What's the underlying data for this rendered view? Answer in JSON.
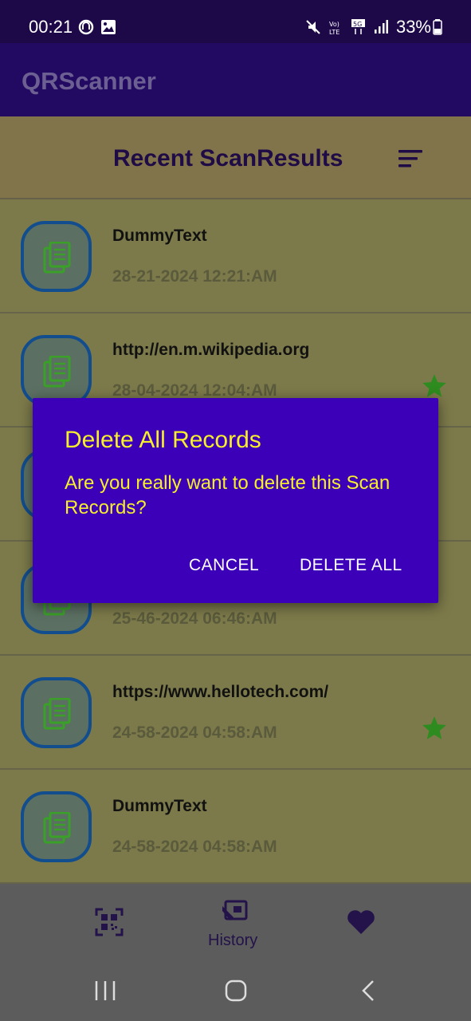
{
  "status_bar": {
    "time": "00:21",
    "battery": "33%"
  },
  "app_bar": {
    "title": "QRScanner"
  },
  "list_header": {
    "title": "Recent ScanResults"
  },
  "records": [
    {
      "text": "DummyText",
      "date": "28-21-2024 12:21:AM",
      "favorite": false
    },
    {
      "text": "http://en.m.wikipedia.org",
      "date": "28-04-2024 12:04:AM",
      "favorite": true
    },
    {
      "text": "",
      "date": "",
      "favorite": false
    },
    {
      "text": "",
      "date": "25-46-2024 06:46:AM",
      "favorite": false
    },
    {
      "text": "https://www.hellotech.com/",
      "date": "24-58-2024 04:58:AM",
      "favorite": true
    },
    {
      "text": "DummyText",
      "date": "24-58-2024 04:58:AM",
      "favorite": false
    }
  ],
  "bottom_nav": {
    "items": [
      {
        "icon": "qr-code-scan-icon",
        "label": ""
      },
      {
        "icon": "history-icon",
        "label": "History"
      },
      {
        "icon": "heart-icon",
        "label": ""
      }
    ]
  },
  "dialog": {
    "title": "Delete All Records",
    "message": "Are you really want to delete this Scan Records?",
    "cancel_label": "CANCEL",
    "confirm_label": "DELETE ALL"
  },
  "colors": {
    "app_bar": "#220962",
    "dialog_bg": "#3b00b8",
    "dialog_text": "#f7ee2c",
    "star": "#2e8b1f"
  }
}
